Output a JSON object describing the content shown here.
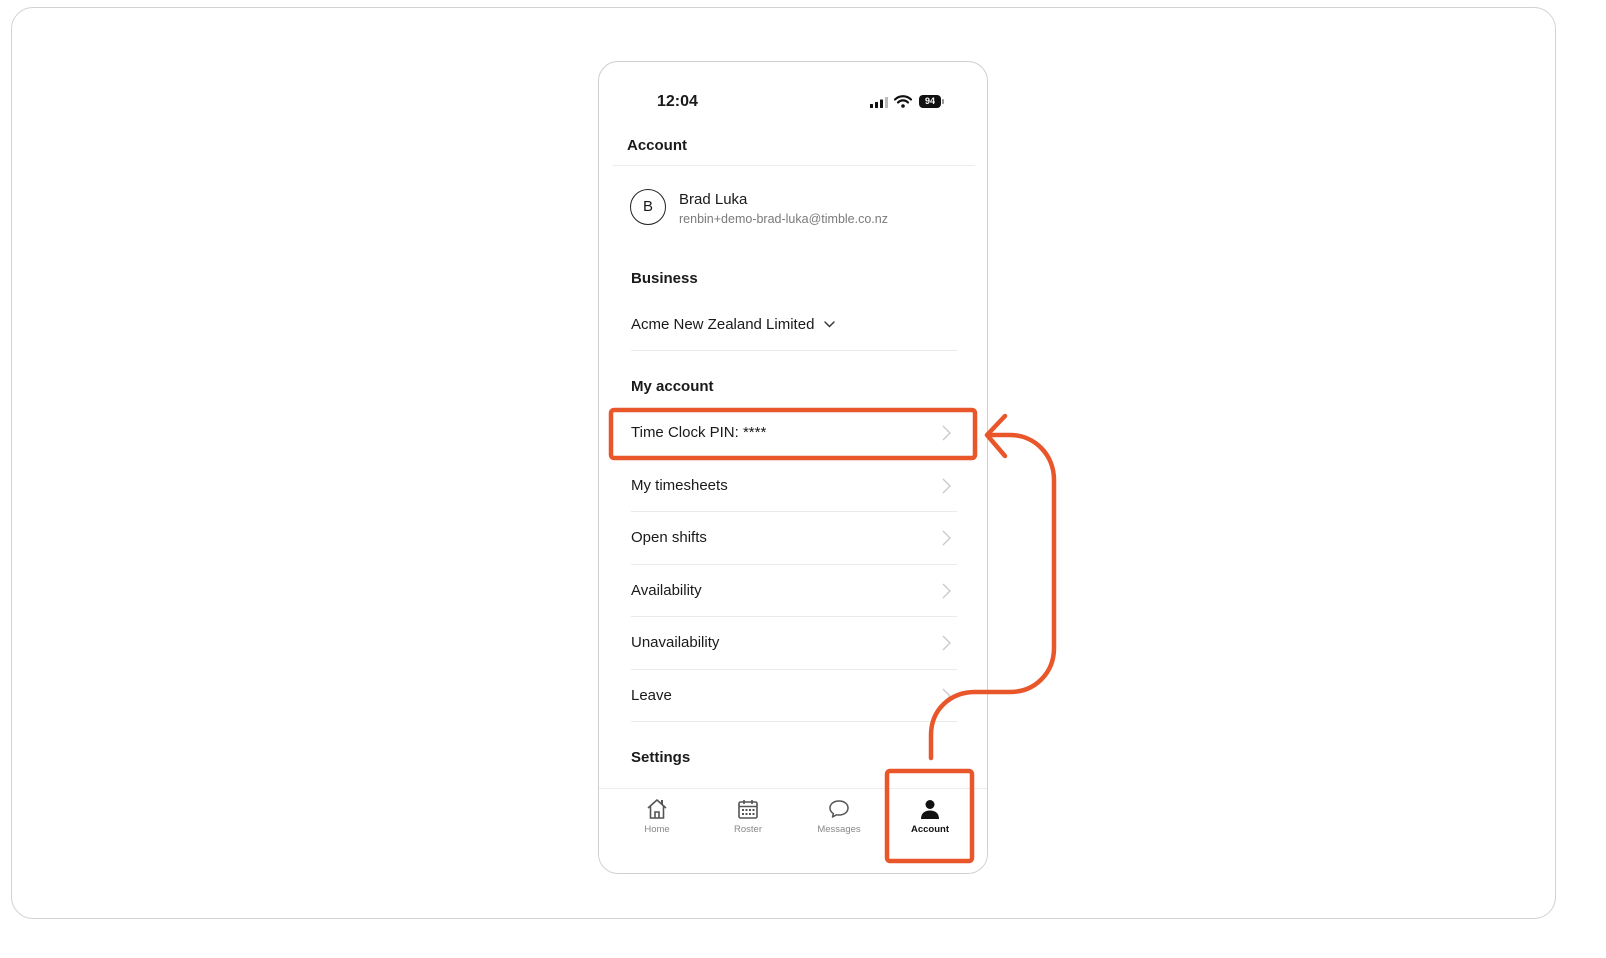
{
  "status_bar": {
    "time": "12:04",
    "battery": "94"
  },
  "header": {
    "title": "Account"
  },
  "profile": {
    "avatar_initial": "B",
    "name": "Brad Luka",
    "email": "renbin+demo-brad-luka@timble.co.nz"
  },
  "business": {
    "heading": "Business",
    "selected": "Acme New Zealand Limited"
  },
  "my_account": {
    "heading": "My account",
    "items": [
      {
        "label": "Time Clock PIN: ****"
      },
      {
        "label": "My timesheets"
      },
      {
        "label": "Open shifts"
      },
      {
        "label": "Availability"
      },
      {
        "label": "Unavailability"
      },
      {
        "label": "Leave"
      }
    ]
  },
  "settings": {
    "heading": "Settings"
  },
  "tab_bar": {
    "tabs": [
      {
        "label": "Home",
        "icon": "home-icon"
      },
      {
        "label": "Roster",
        "icon": "calendar-icon"
      },
      {
        "label": "Messages",
        "icon": "chat-bubble-icon"
      },
      {
        "label": "Account",
        "icon": "person-icon",
        "active": true
      }
    ]
  },
  "colors": {
    "annotation": "#e8562a",
    "text": "#1a1a1a",
    "muted": "#7a7a7a"
  }
}
